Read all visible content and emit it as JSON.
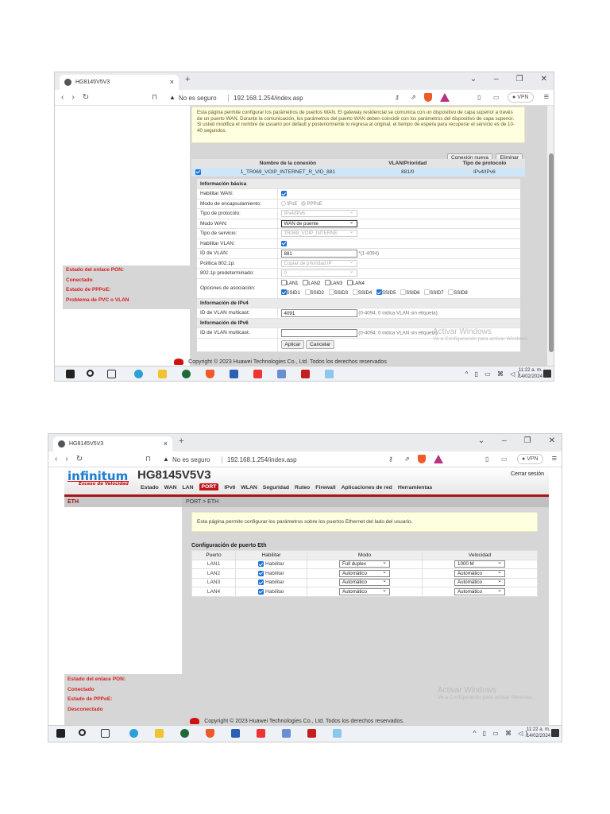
{
  "shot1": {
    "browser": {
      "tab_title": "HG8145V5V3",
      "security": "No es seguro",
      "url": "192.168.1.254/index.asp",
      "vpn": "VPN"
    },
    "notice": [
      "Esta página permite configurar los parámetros de puertos WAN. El gateway residencial se comunica con un dispositivo de capa superior a través de un puerto WAN. Durante la comunicación, los parámetros del puerto WAN deben coincidir con los parámetros del dispositivo de capa superior.",
      "Si usted modifica el nombre de usuario por default y posteriormente lo regresa al original, el tiempo de espera para recuperar el servicio es de 10-40 segundos."
    ],
    "buttons": {
      "new": "Conexión nueva",
      "delete": "Eliminar",
      "apply": "Aplicar",
      "cancel": "Cancelar"
    },
    "table": {
      "headers": [
        "Nombre de la conexión",
        "VLAN/Prioridad",
        "Tipo de protocolo"
      ],
      "row": {
        "name": "1_TR069_VOIP_INTERNET_R_VID_881",
        "vlan": "881/0",
        "protocol": "IPv4/IPv6",
        "selected": true
      }
    },
    "form": {
      "basic_title": "Información básica",
      "enable_wan": "Habilitar WAN:",
      "encap": "Modo de encapsulamiento:",
      "encap_opts": [
        "IPoE",
        "PPPoE"
      ],
      "protocol": "Tipo de protocolo:",
      "protocol_val": "IPv4/IPv6",
      "wan_mode": "Modo WAN:",
      "wan_mode_val": "WAN de puente",
      "service": "Tipo de servicio:",
      "service_val": "TR069_VOIP_INTERNE",
      "enable_vlan": "Habilitar VLAN:",
      "vlan_id": "ID de VLAN:",
      "vlan_id_val": "881",
      "vlan_id_hint": "*(1-4094)",
      "policy": "Política 802.1p:",
      "policy_val": "Copiar de prioridad IP",
      "default_8021p": "802.1p predeterminado:",
      "default_8021p_val": "0",
      "binding": "Opciones de asociación:",
      "lans": [
        "LAN1",
        "LAN2",
        "LAN3",
        "LAN4"
      ],
      "ssids": [
        "SSID1",
        "SSID2",
        "SSID3",
        "SSID4",
        "SSID5",
        "SSID6",
        "SSID7",
        "SSID8"
      ],
      "ssids_checked": [
        "SSID1",
        "SSID5"
      ],
      "ipv4_title": "Información de IPv4",
      "mcast": "ID de VLAN multicast:",
      "ipv4_mcast_val": "4091",
      "mcast_hint": "(0-4094; 0 indica VLAN sin etiqueta).",
      "ipv6_title": "Información de IPv6",
      "ipv6_mcast_val": ""
    },
    "status": [
      "Estado del enlace PON:",
      "Conectado",
      "Estado de PPPoE:",
      "Problema de PVC o VLAN"
    ],
    "copyright": "Copyright © 2023 Huawei Technologies Co., Ltd. Todos los derechos reservados",
    "watermark": {
      "title": "Activar Windows",
      "sub": "Ve a Configuración para activar Windows."
    },
    "taskbar": {
      "time": "11:22 a. m.",
      "date": "14/02/2024"
    }
  },
  "shot2": {
    "browser": {
      "tab_title": "HG8145V5V3",
      "security": "No es seguro",
      "url": "192.168.1.254/index.asp",
      "vpn": "VPN"
    },
    "logo": "infinitum",
    "logo_tagline": "Exceso de Velocidad",
    "device": "HG8145V5V3",
    "logout": "Cerrar sesión",
    "nav": [
      "Estado",
      "WAN",
      "LAN",
      "PORT",
      "IPv6",
      "WLAN",
      "Seguridad",
      "Ruteo",
      "Firewall",
      "Aplicaciones de red",
      "Herramientas"
    ],
    "nav_active": "PORT",
    "side_item": "ETH",
    "breadcrumb": "PORT > ETH",
    "notice": "Esta página permite configurar los parámetros sobre los puertos Ethernet del lado del usuario.",
    "section": "Configuración de puerto Eth",
    "headers": [
      "Puerto",
      "Habilitar",
      "Modo",
      "Velocidad"
    ],
    "rows": [
      {
        "port": "LAN1",
        "enable": "Habilitar",
        "mode": "Full duplex",
        "speed": "1000 M"
      },
      {
        "port": "LAN2",
        "enable": "Habilitar",
        "mode": "Automático",
        "speed": "Automático"
      },
      {
        "port": "LAN3",
        "enable": "Habilitar",
        "mode": "Automático",
        "speed": "Automático"
      },
      {
        "port": "LAN4",
        "enable": "Habilitar",
        "mode": "Automático",
        "speed": "Automático"
      }
    ],
    "status": [
      "Estado del enlace PON:",
      "Conectado",
      "Estado de PPPoE:",
      "Desconectado"
    ],
    "copyright": "Copyright © 2023 Huawei Technologies Co., Ltd. Todos los derechos reservados.",
    "watermark": {
      "title": "Activar Windows",
      "sub": "Ve a Configuración para activar Windows."
    },
    "taskbar": {
      "time": "11:22 a. m.",
      "date": "14/02/2024"
    }
  }
}
